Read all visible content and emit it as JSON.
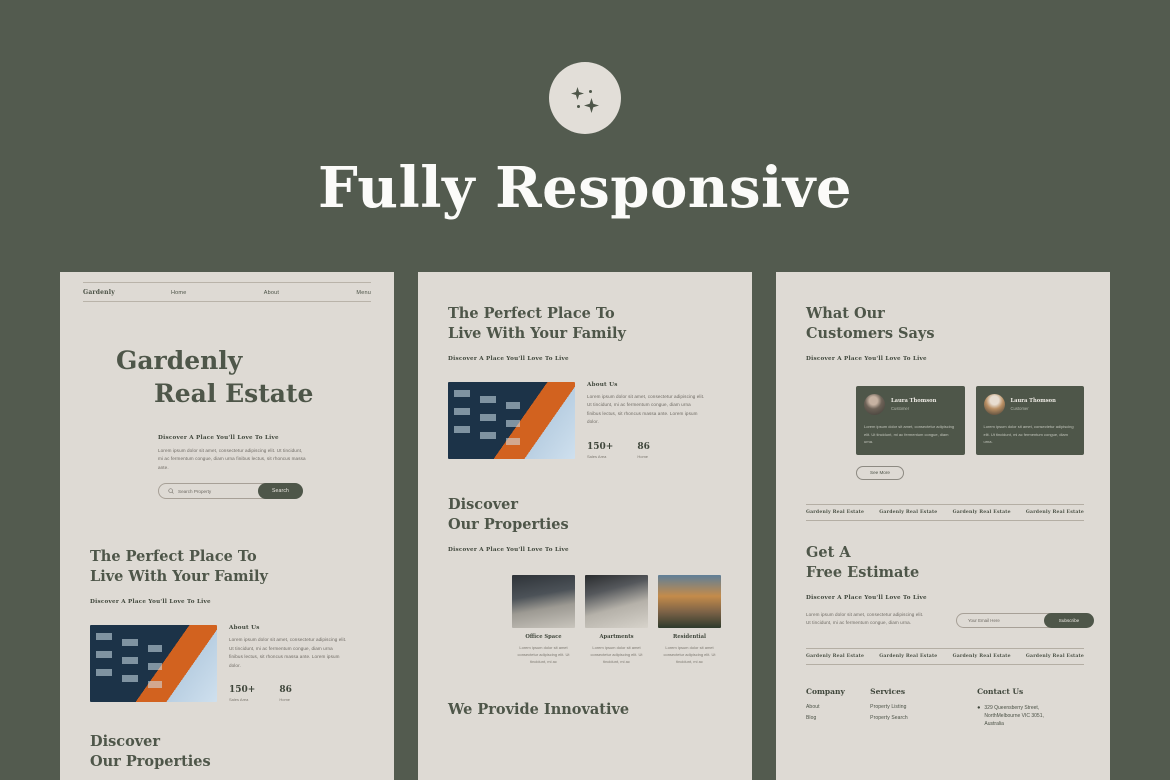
{
  "header": {
    "logo_icon": "sparkle-icon",
    "title": "Fully Responsive"
  },
  "mockups": {
    "nav": {
      "brand": "Gardenly",
      "links": [
        "Home",
        "About",
        "Menu"
      ]
    },
    "hero": {
      "title_line1": "Gardenly",
      "title_line2": "Real Estate",
      "eyebrow": "Discover A Place You'll Love To Live",
      "paragraph": "Lorem ipsum dolor sit amet, consectetur adipiscing elit. Ut tincidunt, mi ac fermentum congue, diam urna finibus lectus, sit rhoncus massa ante.",
      "search_placeholder": "Search Property",
      "search_icon": "search-icon",
      "search_button": "Search"
    },
    "about_section": {
      "title_line1": "The Perfect Place To",
      "title_line2": "Live With Your Family",
      "eyebrow": "Discover A Place You'll Love To Live",
      "about_label": "About Us",
      "about_text": "Lorem ipsum dolor sit amet, consectetur adipiscing elit. Ut tincidunt, mi ac fermentum congue, diam urna finibus lectus, sit rhoncus massa ante. Lorem ipsum dolor.",
      "stats": [
        {
          "value": "150+",
          "label": "Sales Area"
        },
        {
          "value": "86",
          "label": "Home"
        }
      ]
    },
    "properties_section": {
      "title_line1": "Discover",
      "title_line2": "Our Properties",
      "eyebrow": "Discover A Place You'll Love To Live",
      "cards": [
        {
          "title": "Office Space",
          "desc": "Lorem ipsum dolor sit amet consectetur adipiscing elit. Ut tincidunt, mi ac"
        },
        {
          "title": "Apartments",
          "desc": "Lorem ipsum dolor sit amet consectetur adipiscing elit. Ut tincidunt, mi ac"
        },
        {
          "title": "Residential",
          "desc": "Lorem ipsum dolor sit amet consectetur adipiscing elit. Ut tincidunt, mi ac"
        }
      ]
    },
    "innovative_heading": "We Provide Innovative",
    "testimonials_section": {
      "title_line1": "What Our",
      "title_line2": "Customers Says",
      "eyebrow": "Discover A Place You'll Love To Live",
      "cards": [
        {
          "name": "Laura Thomson",
          "role": "Customer",
          "text": "Lorem ipsum dolor sit amet, consectetur adipiscing elit. Ut tincidunt, mi ac fermentum congue, diam urna."
        },
        {
          "name": "Laura Thomson",
          "role": "Customer",
          "text": "Lorem ipsum dolor sit amet, consectetur adipiscing elit. Ut tincidunt, mi ac fermentum congue, diam urna."
        }
      ],
      "see_more": "See More"
    },
    "marquee": [
      "Gardenly Real Estate",
      "Gardenly Real Estate",
      "Gardenly Real Estate",
      "Gardenly Real Estate"
    ],
    "estimate_section": {
      "title_line1": "Get A",
      "title_line2": "Free Estimate",
      "eyebrow": "Discover A Place You'll Love To Live",
      "paragraph": "Lorem ipsum dolor sit amet, consectetur adipiscing elit. Ut tincidunt, mi ac fermentum congue, diam urna.",
      "email_placeholder": "Your Email Here",
      "subscribe_button": "Subscribe"
    },
    "footer": {
      "company": {
        "heading": "Company",
        "links": [
          "About",
          "Blog"
        ]
      },
      "services": {
        "heading": "Services",
        "links": [
          "Property Listing",
          "Property Search"
        ]
      },
      "contact": {
        "heading": "Contact Us",
        "pin_icon": "location-pin-icon",
        "address_line1": "329 Queensberry Street,",
        "address_line2": "NorthMelbourne VIC 3051,",
        "address_line3": "Australia"
      }
    }
  },
  "colors": {
    "background": "#535b4f",
    "panel": "#dedad4",
    "accent": "#4e5649",
    "title_text": "#fbfbf9"
  }
}
